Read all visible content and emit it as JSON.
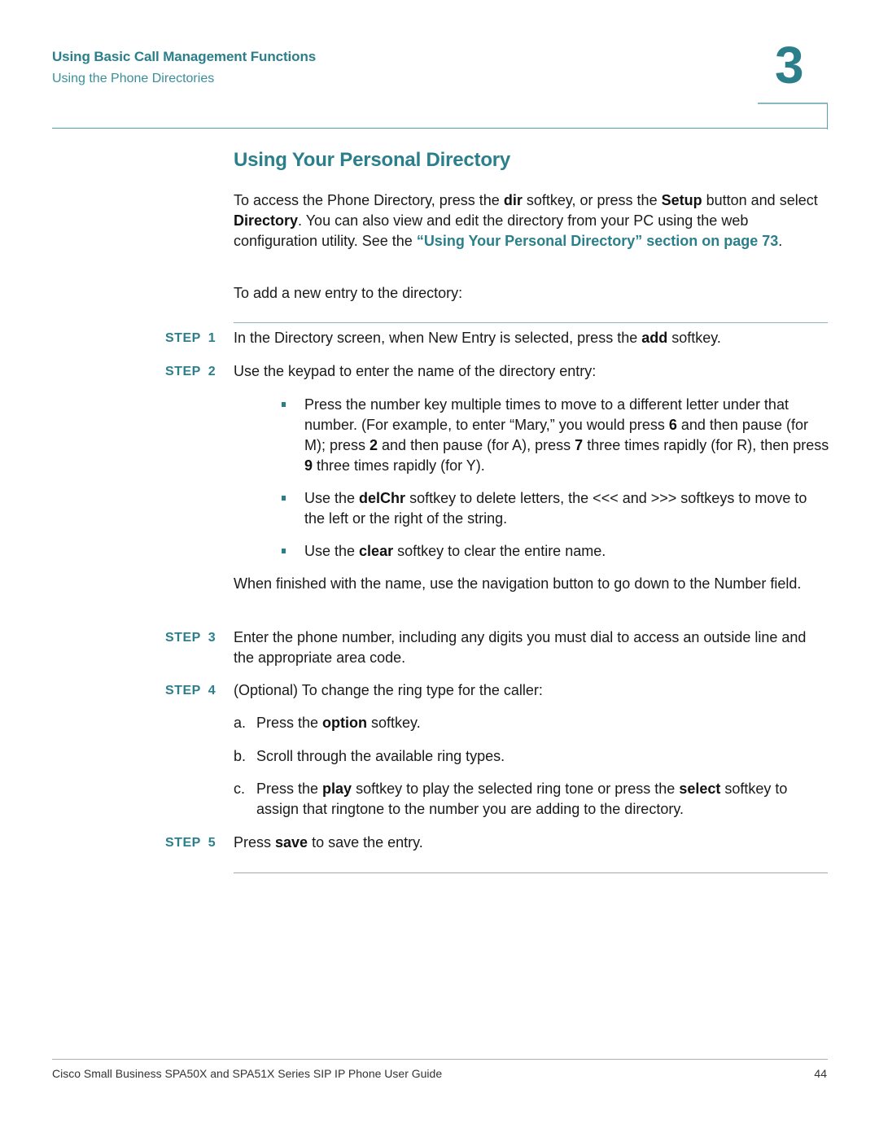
{
  "header": {
    "chapter_title": "Using Basic Call Management Functions",
    "section_title": "Using the Phone Directories",
    "chapter_number": "3"
  },
  "heading": "Using Your Personal Directory",
  "intro": {
    "p1_a": "To access the Phone Directory, press the ",
    "p1_b": "dir",
    "p1_c": " softkey, or press the ",
    "p1_d": "Setup",
    "p1_e": " button and select ",
    "p1_f": "Directory",
    "p1_g": ". You can also view and edit the directory from your PC using the web configuration utility. See the ",
    "link": "“Using Your Personal Directory” section on page 73",
    "p1_h": "."
  },
  "add_intro": "To add a new entry to the directory:",
  "step_word": "STEP",
  "steps": [
    {
      "num": "1",
      "a": "In the Directory screen, when New Entry is selected, press the ",
      "b": "add",
      "c": " softkey."
    },
    {
      "num": "2",
      "a": "Use the keypad to enter the name of the directory entry:",
      "bullets": [
        {
          "a": "Press the number key multiple times to move to a different letter under that number. (For example, to enter “Mary,” you would press ",
          "b": "6",
          "c": " and then pause (for M); press ",
          "d": "2",
          "e": " and then pause (for A), press ",
          "f": "7",
          "g": " three times rapidly (for R), then press ",
          "h": "9",
          "i": " three times rapidly (for Y)."
        },
        {
          "a": "Use the ",
          "b": "delChr",
          "c": " softkey to delete letters, the <<< and >>> softkeys to move to the left or the right of the string."
        },
        {
          "a": "Use the ",
          "b": "clear",
          "c": " softkey to clear the entire name."
        }
      ],
      "after": "When finished with the name, use the navigation button to go down to the Number field."
    },
    {
      "num": "3",
      "a": "Enter the phone number, including any digits you must dial to access an outside line and the appropriate area code."
    },
    {
      "num": "4",
      "a": "(Optional) To change the ring type for the caller:",
      "substeps": [
        {
          "letter": "a.",
          "a": "Press the ",
          "b": "option",
          "c": " softkey."
        },
        {
          "letter": "b.",
          "a": "Scroll through the available ring types."
        },
        {
          "letter": "c.",
          "a": "Press the ",
          "b": "play",
          "c": " softkey to play the selected ring tone or press the ",
          "d": "select",
          "e": " softkey to assign that ringtone to the number you are adding to the directory."
        }
      ]
    },
    {
      "num": "5",
      "a": "Press ",
      "b": "save",
      "c": " to save the entry."
    }
  ],
  "footer": {
    "guide_title": "Cisco Small Business SPA50X and SPA51X Series SIP IP Phone User Guide",
    "page_number": "44"
  },
  "colors": {
    "accent": "#2b7f8a",
    "rule_teal": "#8ab8bf",
    "rule_gray": "#a8a8a8"
  }
}
